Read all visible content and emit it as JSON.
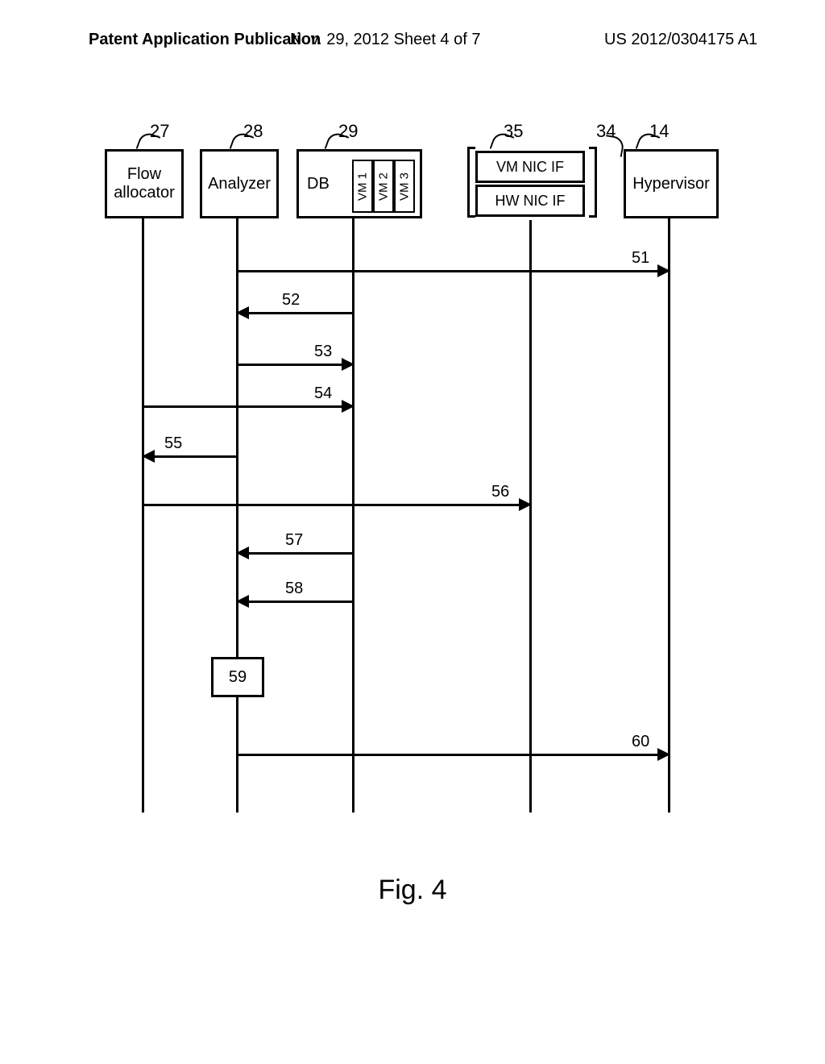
{
  "header": {
    "left": "Patent Application Publication",
    "center": "Nov. 29, 2012  Sheet 4 of 7",
    "right": "US 2012/0304175 A1"
  },
  "actors": {
    "flow_allocator": {
      "ref": "27",
      "label": "Flow\nallocator"
    },
    "analyzer": {
      "ref": "28",
      "label": "Analyzer"
    },
    "db": {
      "ref": "29",
      "label": "DB",
      "slots": [
        "VM 1",
        "VM 2",
        "VM 3"
      ]
    },
    "nic": {
      "vm_ref": "35",
      "hw_ref": "34",
      "vm_label": "VM NIC IF",
      "hw_label": "HW NIC IF"
    },
    "hypervisor": {
      "ref": "14",
      "label": "Hypervisor"
    }
  },
  "messages": {
    "m51": "51",
    "m52": "52",
    "m53": "53",
    "m54": "54",
    "m55": "55",
    "m56": "56",
    "m57": "57",
    "m58": "58",
    "m59": "59",
    "m60": "60"
  },
  "figure_caption": "Fig. 4"
}
